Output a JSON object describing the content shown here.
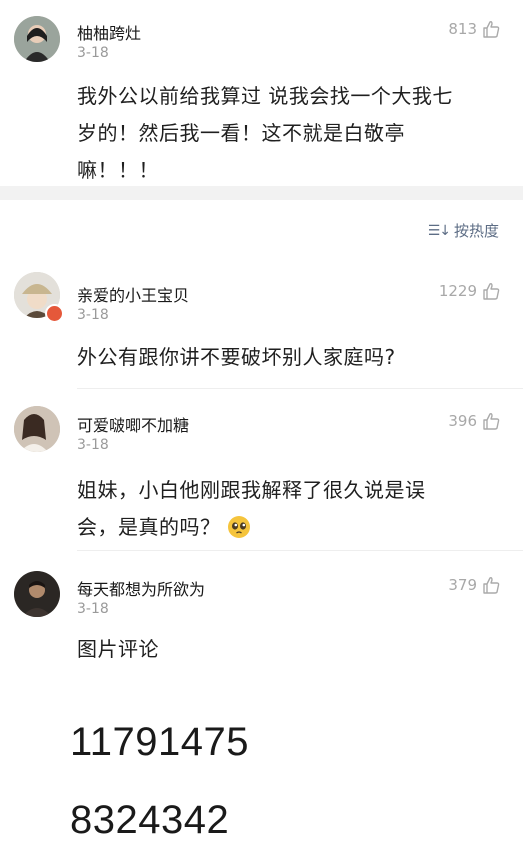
{
  "comments": [
    {
      "username": "柚柚跨灶",
      "date": "3-18",
      "likes": "813",
      "lines": [
        "我外公以前给我算过 说我会找一个大我七",
        "岁的！然后我一看！这不就是白敬亭",
        "嘛！！！"
      ]
    },
    {
      "username": "亲爱的小王宝贝",
      "date": "3-18",
      "likes": "1229",
      "lines": [
        "外公有跟你讲不要破坏别人家庭吗?"
      ]
    },
    {
      "username": "可爱啵唧不加糖",
      "date": "3-18",
      "likes": "396",
      "lines": [
        "姐妹，小白他刚跟我解释了很久说是误",
        "会，是真的吗？"
      ]
    },
    {
      "username": "每天都想为所欲为",
      "date": "3-18",
      "likes": "379",
      "lines": [
        "图片评论"
      ]
    }
  ],
  "sort": {
    "label": "按热度",
    "icon": "sort-lines-icon"
  },
  "image_comment_numbers": [
    "11791475",
    "8324342"
  ],
  "icons": {
    "like": "thumbs-up-icon",
    "emoji": "pleading-face-emoji"
  },
  "colors": {
    "sort_text": "#5d6d85",
    "meta": "#9a9a9a",
    "divider": "#f2f2f2"
  }
}
